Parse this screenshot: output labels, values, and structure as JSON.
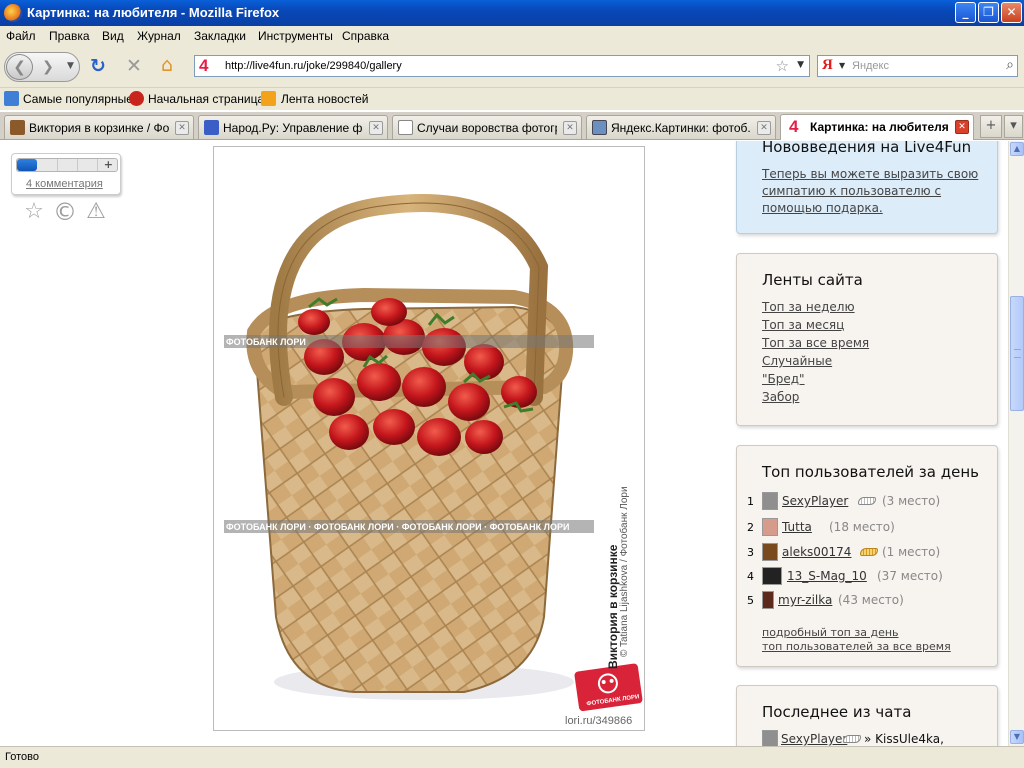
{
  "window": {
    "title": "Картинка: на любителя - Mozilla Firefox",
    "controls": [
      "_",
      "❐",
      "✕"
    ]
  },
  "menu": [
    "Файл",
    "Правка",
    "Вид",
    "Журнал",
    "Закладки",
    "Инструменты",
    "Справка"
  ],
  "nav": {
    "url": "http://live4fun.ru/joke/299840/gallery",
    "site_badge": "4",
    "search_engine_badge": "Я",
    "search_placeholder": "Яндекс"
  },
  "bookmarks": [
    {
      "label": "Самые популярные",
      "color": "#3f7fd6"
    },
    {
      "label": "Начальная страница",
      "color": "#c8261d"
    },
    {
      "label": "Лента новостей",
      "color": "#f3a21c"
    }
  ],
  "tabs": [
    {
      "label": "Виктория в корзинке / Фо...",
      "icon_color": "#8a5a2b",
      "active": false
    },
    {
      "label": "Народ.Ру: Управление фа...",
      "icon_color": "#3a5ec6",
      "active": false
    },
    {
      "label": "Случаи воровства фотогр...",
      "icon_color": "#ffffff",
      "active": false
    },
    {
      "label": "Яндекс.Картинки: фотоб...",
      "icon_color": "#6b8fbf",
      "active": false
    },
    {
      "label": "Картинка: на любителя",
      "icon_color": "#e21f45",
      "icon_text": "4",
      "active": true
    }
  ],
  "tab_buttons": [
    "+",
    "▾"
  ],
  "rating": {
    "fraction": 0.2,
    "plus_label": "+",
    "comments_label": "4 комментария"
  },
  "actions": [
    {
      "name": "favorite-star-icon",
      "glyph": "☆"
    },
    {
      "name": "copyright-icon",
      "glyph": "©"
    },
    {
      "name": "report-warning-icon",
      "glyph": "⚠"
    }
  ],
  "photo": {
    "caption_main": "Виктория в корзинке",
    "caption_sub": "© Tatiana Lijashkova / Фотобанк Лори",
    "watermark": "ФОТОБАНК ЛОРИ",
    "logo_text": "ФОТОБАНК ЛОРИ",
    "photo_id": "lori.ru/349866"
  },
  "sidebar": {
    "news": {
      "title": "Нововведения на Live4Fun",
      "text": "Теперь вы можете выразить свою симпатию к пользователю с помощью подарка."
    },
    "feeds": {
      "title": "Ленты сайта",
      "links": [
        "Топ за неделю",
        "Топ за месяц",
        "Топ за все время",
        "Случайные",
        "\"Бред\"",
        "Забор"
      ]
    },
    "top_users": {
      "title": "Топ пользователей за день",
      "users": [
        {
          "rank": "1",
          "name": "SexyPlayer",
          "place": "(3 место)",
          "wing": "silver",
          "avatar": "#8f8f8f"
        },
        {
          "rank": "2",
          "name": "Tutta",
          "place": "(18 место)",
          "wing": "",
          "avatar": "#d69b8a"
        },
        {
          "rank": "3",
          "name": "aleks00174",
          "place": "(1 место)",
          "wing": "gold",
          "avatar": "#7a4a1f"
        },
        {
          "rank": "4",
          "name": "13_S-Mag_10",
          "place": "(37 место)",
          "wing": "",
          "avatar": "#222222"
        },
        {
          "rank": "5",
          "name": "myr-zilka",
          "place": "(43 место)",
          "wing": "",
          "avatar": "#5b2a1c"
        }
      ],
      "link_detailed": "подробный топ за день",
      "link_alltime": "топ пользователей за все время"
    },
    "chat": {
      "title": "Последнее из чата",
      "user": "SexyPlayer",
      "text": "» KissUle4ka,"
    }
  },
  "status": "Готово"
}
